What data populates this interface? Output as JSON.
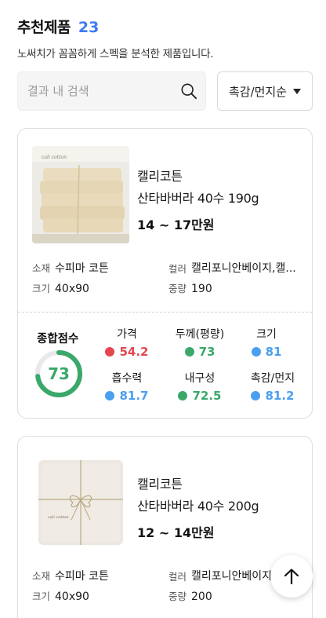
{
  "header": {
    "title": "추천제품",
    "count": "23",
    "subtitle": "노써치가 꼼꼼하게 스펙을 분석한 제품입니다."
  },
  "search": {
    "placeholder": "결과 내 검색",
    "value": "",
    "icon": "search-icon"
  },
  "sort": {
    "label": "촉감/먼지순"
  },
  "colors": {
    "accent": "#3d7cf2",
    "score_red": "#e5464f",
    "score_green": "#3aa86a",
    "score_blue": "#4a9ff0"
  },
  "products": [
    {
      "brand": "캘리코튼",
      "name": "산타바버라 40수 190g",
      "price": "14 ~ 17만원",
      "specs": {
        "material_label": "소재",
        "material": "수피마 코튼",
        "color_label": "컬러",
        "color": "캘리포니안베이지,캘...",
        "size_label": "크기",
        "size": "40x90",
        "weight_label": "중량",
        "weight": "190"
      },
      "total_label": "종합점수",
      "total_score": "73",
      "total_fraction": 0.73,
      "metrics": [
        {
          "label": "가격",
          "value": "54.2",
          "color": "red"
        },
        {
          "label": "두께(평량)",
          "value": "73",
          "color": "green"
        },
        {
          "label": "크기",
          "value": "81",
          "color": "blue"
        },
        {
          "label": "흡수력",
          "value": "81.7",
          "color": "blue"
        },
        {
          "label": "내구성",
          "value": "72.5",
          "color": "green"
        },
        {
          "label": "촉감/먼지",
          "value": "81.2",
          "color": "blue"
        }
      ]
    },
    {
      "brand": "캘리코튼",
      "name": "산타바버라 40수 200g",
      "price": "12 ~ 14만원",
      "specs": {
        "material_label": "소재",
        "material": "수피마 코튼",
        "color_label": "컬러",
        "color": "캘리포니안베이지",
        "size_label": "크기",
        "size": "40x90",
        "weight_label": "중량",
        "weight": "200"
      }
    }
  ],
  "fab": {
    "icon": "arrow-up-icon"
  }
}
